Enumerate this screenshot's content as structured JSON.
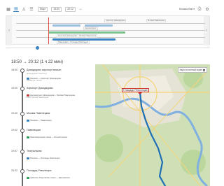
{
  "toolbar": {
    "select_date": "Март",
    "select_from": "18:30",
    "select_to": "20:12",
    "user": "Москва Нав ▾"
  },
  "timeline": {
    "labels": [
      "Аэропорт Домодедово",
      "Москва Павелецкая",
      "Аэроэкспресс",
      "Аэропорт Домодедово – Москва Павелецкая",
      "Павелецкая – Площадь Революции"
    ]
  },
  "route": {
    "header": "18:50 → 20:12 (1 ч 22 мин)",
    "stops": [
      {
        "time": "18:50",
        "name": "Домодедово аэропорт вокзал",
        "sub": "Домодедово аэропорт"
      },
      {
        "time": "19:00",
        "name": "Аэропорт Домодедово",
        "sub": ""
      },
      {
        "time": "19:40",
        "name": "Москва Павелецкая",
        "sub": ""
      },
      {
        "time": "19:42",
        "name": "Павелецкая",
        "sub": ""
      },
      {
        "time": "19:57",
        "name": "Театральная",
        "sub": ""
      },
      {
        "time": "20:02",
        "name": "Площадь Революции",
        "sub": ""
      }
    ],
    "legs": [
      {
        "mode": "walk",
        "text": "Пешком — Аэропорт Домодедово",
        "sub": "Прибытие в 19:00"
      },
      {
        "mode": "train",
        "text": "Аэроэкспресс Домодедово – Москва Павелецкая",
        "sub": "19:00 Москва Павелецкая"
      },
      {
        "mode": "walk",
        "text": "Пешком — Павелецкая",
        "sub": ""
      },
      {
        "mode": "metro",
        "text": "Замоскворецкая линия — Речной вокзал",
        "sub": ""
      },
      {
        "mode": "walk",
        "text": "Пешком — Площадь Революции",
        "sub": ""
      },
      {
        "mode": "metro",
        "text": "Арбатско-Покровская линия — Щёлковская",
        "sub": ""
      }
    ]
  },
  "map": {
    "toggle_label": "Карта в полный экран",
    "center_label": "Площадь Революции",
    "colors": {
      "route": "#1f6fb5",
      "river": "#7fb0e0",
      "land": "#cfe0b7",
      "city": "#e7e3d9"
    }
  }
}
